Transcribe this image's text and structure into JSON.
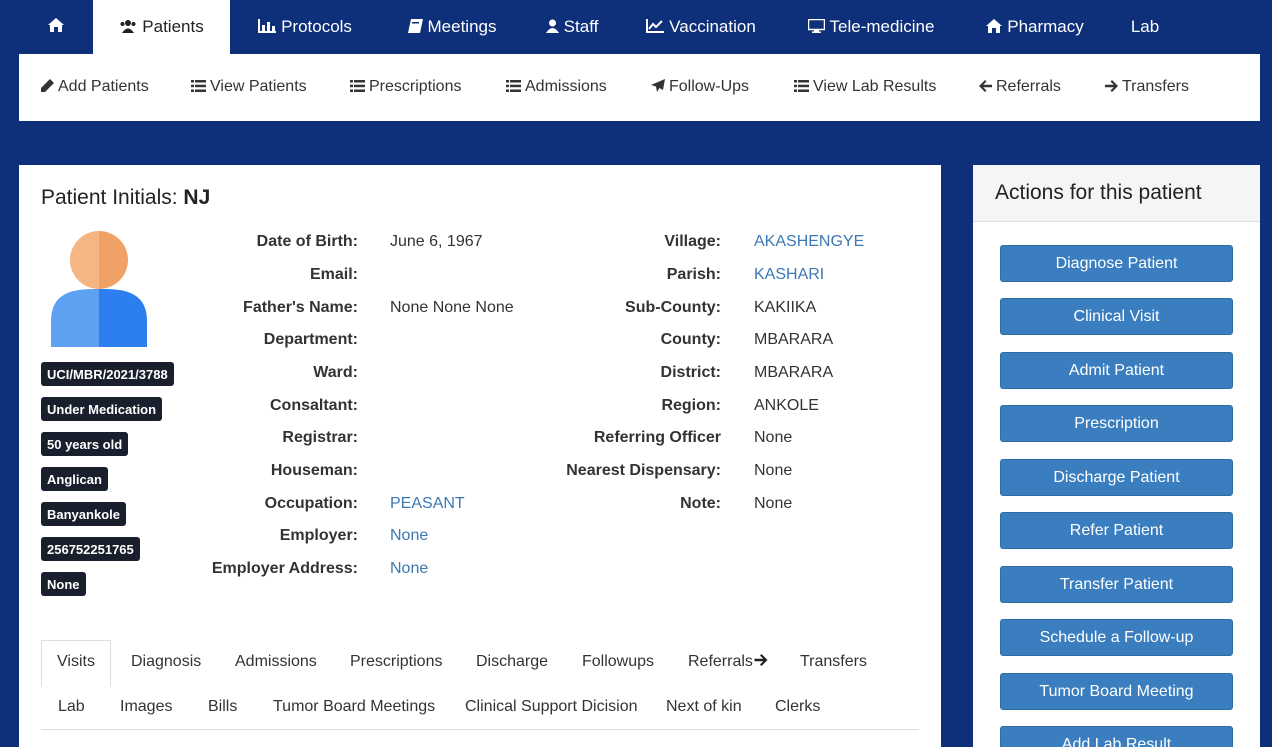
{
  "topnav": {
    "items": [
      {
        "label": "",
        "icon": "home-icon"
      },
      {
        "label": "Patients",
        "icon": "users-icon"
      },
      {
        "label": "Protocols",
        "icon": "bar-chart-icon"
      },
      {
        "label": "Meetings",
        "icon": "book-icon"
      },
      {
        "label": "Staff",
        "icon": "user-icon"
      },
      {
        "label": "Vaccination",
        "icon": "line-chart-icon"
      },
      {
        "label": "Tele-medicine",
        "icon": "desktop-icon"
      },
      {
        "label": "Pharmacy",
        "icon": "home-icon"
      },
      {
        "label": "Lab",
        "icon": ""
      }
    ]
  },
  "subnav": {
    "items": [
      {
        "label": "Add Patients",
        "icon": "pencil-icon"
      },
      {
        "label": "View Patients",
        "icon": "list-icon"
      },
      {
        "label": "Prescriptions",
        "icon": "list-icon"
      },
      {
        "label": "Admissions",
        "icon": "list-icon"
      },
      {
        "label": "Follow-Ups",
        "icon": "paper-plane-icon"
      },
      {
        "label": "View Lab Results",
        "icon": "list-icon"
      },
      {
        "label": "Referrals",
        "icon": "arrow-left-icon"
      },
      {
        "label": "Transfers",
        "icon": "arrow-right-icon"
      }
    ]
  },
  "patient": {
    "title_prefix": "Patient Initials: ",
    "initials": "NJ",
    "badges": [
      "UCI/MBR/2021/3788",
      "Under Medication",
      "50 years old",
      "Anglican",
      "Banyankole",
      "256752251765",
      "None"
    ],
    "left_fields": [
      {
        "label": "Date of Birth:",
        "value": "June 6, 1967"
      },
      {
        "label": "Email:",
        "value": ""
      },
      {
        "label": "Father's Name:",
        "value": "None None None"
      },
      {
        "label": "Department:",
        "value": ""
      },
      {
        "label": "Ward:",
        "value": ""
      },
      {
        "label": "Consaltant:",
        "value": ""
      },
      {
        "label": "Registrar:",
        "value": ""
      },
      {
        "label": "Houseman:",
        "value": ""
      },
      {
        "label": "Occupation:",
        "value": "PEASANT"
      },
      {
        "label": "Employer:",
        "value": "None"
      },
      {
        "label": "Employer Address:",
        "value": "None"
      }
    ],
    "right_fields": [
      {
        "label": "Village:",
        "value": "AKASHENGYE"
      },
      {
        "label": "Parish:",
        "value": "KASHARI"
      },
      {
        "label": "Sub-County:",
        "value": "KAKIIKA"
      },
      {
        "label": "County:",
        "value": "MBARARA"
      },
      {
        "label": "District:",
        "value": "MBARARA"
      },
      {
        "label": "Region:",
        "value": "ANKOLE"
      },
      {
        "label": "Referring Officer",
        "value": "None"
      },
      {
        "label": "Nearest Dispensary:",
        "value": "None"
      },
      {
        "label": "Note:",
        "value": "None"
      }
    ]
  },
  "tabs": {
    "row1": [
      "Visits",
      "Diagnosis",
      "Admissions",
      "Prescriptions",
      "Discharge",
      "Followups",
      "Referrals",
      "Transfers"
    ],
    "row2": [
      "Lab",
      "Images",
      "Bills",
      "Tumor Board Meetings",
      "Clinical Support Dicision",
      "Next of kin",
      "Clerks"
    ]
  },
  "actions": {
    "title": "Actions for this patient",
    "buttons": [
      "Diagnose Patient",
      "Clinical Visit",
      "Admit Patient",
      "Prescription",
      "Discharge Patient",
      "Refer Patient",
      "Transfer Patient",
      "Schedule a Follow-up",
      "Tumor Board Meeting",
      "Add Lab Result"
    ]
  },
  "colors": {
    "background": "#0e2f7a",
    "button": "#3a7ec0",
    "link": "#3c78b5",
    "badge": "#1a1f2e"
  }
}
